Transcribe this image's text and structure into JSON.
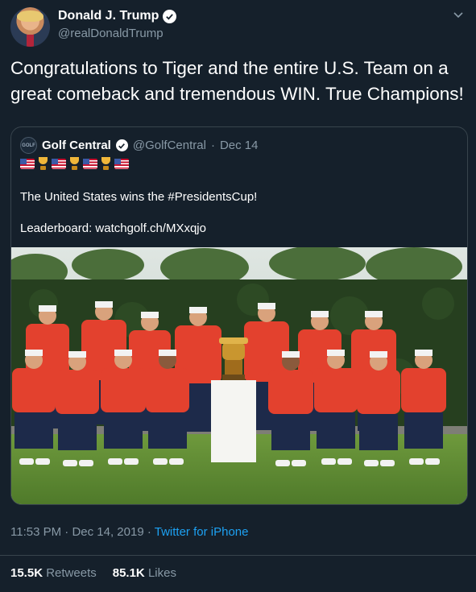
{
  "tweet": {
    "author_name": "Donald J. Trump",
    "author_handle": "@realDonaldTrump",
    "text": "Congratulations to Tiger and the entire U.S. Team on a great comeback and tremendous WIN. True Champions!",
    "time": "11:53 PM",
    "date": "Dec 14, 2019",
    "separator": "·",
    "source": "Twitter for iPhone",
    "retweets_count": "15.5K",
    "retweets_label": "Retweets",
    "likes_count": "85.1K",
    "likes_label": "Likes"
  },
  "quoted": {
    "logo_text": "GOLF",
    "author_name": "Golf Central",
    "author_handle": "@GolfCentral",
    "separator": "·",
    "date": "Dec 14",
    "emoji": [
      "flag-us",
      "trophy",
      "flag-us",
      "trophy",
      "flag-us",
      "trophy",
      "flag-us"
    ],
    "text_line1": "The United States wins the #PresidentsCup!",
    "text_line2": "Leaderboard: watchgolf.ch/MXxqjo"
  },
  "colors": {
    "background": "#15202b",
    "secondary_text": "#8899a6",
    "link": "#1da1f2",
    "border": "#38444d",
    "team_shirt": "#e3412e",
    "team_pants": "#1d2a4a"
  },
  "icons": {
    "verified": "verified-badge-icon",
    "menu": "chevron-down-icon"
  }
}
